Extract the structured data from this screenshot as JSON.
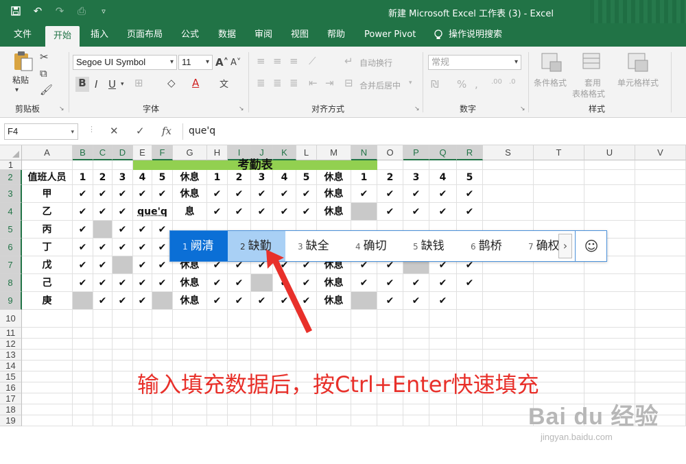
{
  "titlebar": {
    "title": "新建 Microsoft Excel 工作表 (3)  -  Excel"
  },
  "tabs": [
    "文件",
    "开始",
    "插入",
    "页面布局",
    "公式",
    "数据",
    "审阅",
    "视图",
    "帮助",
    "Power Pivot"
  ],
  "tell_me": "操作说明搜索",
  "ribbon": {
    "paste": "粘贴",
    "font_name": "Segoe UI Symbol",
    "font_size": "11",
    "wrap_text": "自动换行",
    "merge_center": "合并后居中",
    "number_format": "常规",
    "cond_format": "条件格式",
    "table_format_1": "套用",
    "table_format_2": "表格格式",
    "cell_styles": "单元格样式",
    "groups": {
      "clipboard": "剪贴板",
      "font": "字体",
      "alignment": "对齐方式",
      "number": "数字",
      "styles": "样式"
    }
  },
  "formula_bar": {
    "name_box": "F4",
    "value": "que'q"
  },
  "columns": [
    "A",
    "B",
    "C",
    "D",
    "E",
    "F",
    "G",
    "H",
    "I",
    "J",
    "K",
    "L",
    "M",
    "N",
    "O",
    "P",
    "Q",
    "R",
    "S",
    "T",
    "U",
    "V"
  ],
  "rows": [
    "1",
    "2",
    "3",
    "4",
    "5",
    "6",
    "7",
    "8",
    "9",
    "10",
    "11",
    "12",
    "13",
    "14",
    "15",
    "16",
    "17",
    "18",
    "19"
  ],
  "sheet": {
    "title": "考勤表",
    "header_row": [
      "值班人员",
      "1",
      "2",
      "3",
      "4",
      "5",
      "休息",
      "1",
      "2",
      "3",
      "4",
      "5",
      "休息",
      "1",
      "2",
      "3",
      "4",
      "5"
    ],
    "data_rows": [
      [
        "甲",
        "✔",
        "✔",
        "✔",
        "✔",
        "✔",
        "休息",
        "✔",
        "✔",
        "✔",
        "✔",
        "✔",
        "休息",
        "✔",
        "✔",
        "✔",
        "✔",
        "✔"
      ],
      [
        "乙",
        "✔",
        "✔",
        "✔",
        "que'q",
        "",
        "息",
        "✔",
        "✔",
        "✔",
        "✔",
        "✔",
        "休息",
        "",
        "✔",
        "✔",
        "✔",
        "✔"
      ],
      [
        "丙",
        "✔",
        "",
        "✔",
        "✔",
        "✔",
        "",
        "",
        "",
        "",
        "",
        "",
        "",
        "",
        "",
        "",
        "",
        ""
      ],
      [
        "丁",
        "✔",
        "✔",
        "✔",
        "✔",
        "✔",
        "",
        "",
        "",
        "",
        "",
        "",
        "",
        "",
        "",
        "",
        "",
        ""
      ],
      [
        "戊",
        "✔",
        "✔",
        "",
        "✔",
        "✔",
        "休息",
        "✔",
        "✔",
        "✔",
        "✔",
        "✔",
        "休息",
        "✔",
        "✔",
        "",
        "✔",
        "✔"
      ],
      [
        "己",
        "✔",
        "✔",
        "✔",
        "✔",
        "✔",
        "休息",
        "✔",
        "✔",
        "",
        "✔",
        "✔",
        "休息",
        "✔",
        "✔",
        "✔",
        "✔",
        "✔"
      ],
      [
        "庚",
        "",
        "✔",
        "✔",
        "✔",
        "",
        "休息",
        "✔",
        "✔",
        "✔",
        "✔",
        "✔",
        "休息",
        "",
        "✔",
        "✔",
        "✔",
        ""
      ]
    ],
    "gray_cells": [
      [
        1,
        13
      ],
      [
        2,
        2
      ],
      [
        4,
        3
      ],
      [
        4,
        15
      ],
      [
        5,
        9
      ],
      [
        6,
        1
      ],
      [
        6,
        5
      ],
      [
        6,
        13
      ],
      [
        6,
        18
      ]
    ]
  },
  "ime": {
    "candidates": [
      {
        "num": "1",
        "text": "阙清"
      },
      {
        "num": "2",
        "text": "缺勤"
      },
      {
        "num": "3",
        "text": "缺全"
      },
      {
        "num": "4",
        "text": "确切"
      },
      {
        "num": "5",
        "text": "缺钱"
      },
      {
        "num": "6",
        "text": "鹊桥"
      },
      {
        "num": "7",
        "text": "确权"
      }
    ]
  },
  "annotation": {
    "caption": "输入填充数据后，按Ctrl+Enter快速填充",
    "arrow_color": "#e8302a"
  },
  "watermark": {
    "main": "Bai  du 经验",
    "sub": "jingyan.baidu.com"
  },
  "colors": {
    "excel_green": "#217346",
    "title_fill": "#92d050",
    "gray_fill": "#c9c9c9",
    "ime_highlight": "#0b6fd6"
  }
}
